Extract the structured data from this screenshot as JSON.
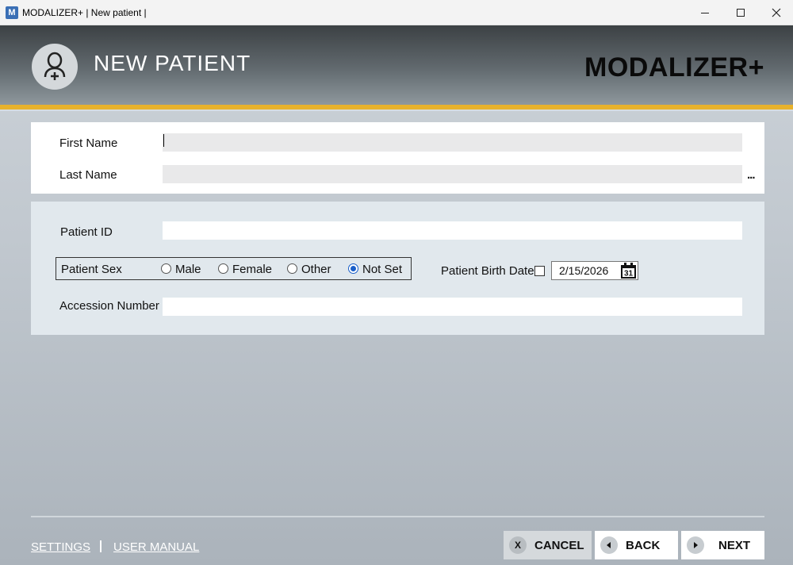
{
  "window": {
    "title": "MODALIZER+ | New patient |",
    "icon_letter": "M"
  },
  "header": {
    "title": "NEW PATIENT",
    "brand": "MODALIZER+"
  },
  "name_panel": {
    "first_name_label": "First Name",
    "first_name_value": "",
    "last_name_label": "Last Name",
    "last_name_value": "",
    "more_button": "..."
  },
  "details_panel": {
    "patient_id_label": "Patient ID",
    "patient_id_value": "",
    "sex_label": "Patient Sex",
    "sex_options": [
      "Male",
      "Female",
      "Other",
      "Not Set"
    ],
    "sex_selected": "Not Set",
    "birth_date_label": "Patient Birth Date",
    "birth_date_enabled": false,
    "birth_date_value": "2/15/2026",
    "calendar_day": "31",
    "accession_label": "Accession Number",
    "accession_value": ""
  },
  "footer": {
    "settings_link": "SETTINGS",
    "manual_link": "USER MANUAL",
    "cancel_label": "CANCEL",
    "back_label": "BACK",
    "next_label": "NEXT"
  },
  "colors": {
    "accent_stripe": "#e7b22d",
    "radio_selected": "#1a5fc9"
  }
}
